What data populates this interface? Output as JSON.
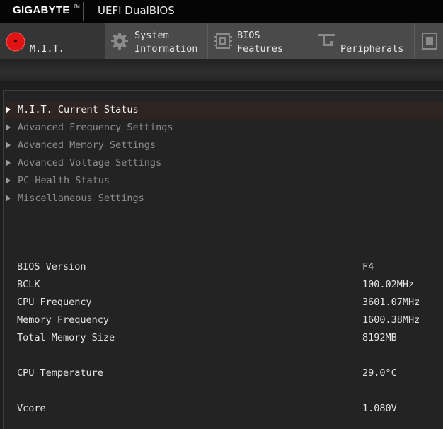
{
  "header": {
    "brand": "GIGABYTE",
    "trademark": "TM",
    "product": "UEFI DualBIOS"
  },
  "tabs": [
    {
      "line1": "",
      "line2": "M.I.T.",
      "icon": "red-status-dot-icon",
      "active": true
    },
    {
      "line1": "System",
      "line2": "Information",
      "icon": "gear-icon"
    },
    {
      "line1": "BIOS",
      "line2": "Features",
      "icon": "chip-icon"
    },
    {
      "line1": "",
      "line2": "Peripherals",
      "icon": "connector-icon"
    },
    {
      "line1": "",
      "line2": "",
      "icon": "board-icon"
    }
  ],
  "menu": [
    {
      "label": "M.I.T. Current Status",
      "selected": true
    },
    {
      "label": "Advanced Frequency Settings"
    },
    {
      "label": "Advanced Memory Settings"
    },
    {
      "label": "Advanced Voltage Settings"
    },
    {
      "label": "PC Health Status"
    },
    {
      "label": "Miscellaneous Settings"
    }
  ],
  "info": [
    {
      "label": "BIOS Version",
      "value": "F4"
    },
    {
      "label": "BCLK",
      "value": "100.02MHz"
    },
    {
      "label": "CPU Frequency",
      "value": "3601.07MHz"
    },
    {
      "label": "Memory Frequency",
      "value": "1600.38MHz"
    },
    {
      "label": "Total Memory Size",
      "value": "8192MB"
    },
    {
      "label": "CPU Temperature",
      "value": "29.0°C"
    },
    {
      "label": "Vcore",
      "value": "1.080V"
    }
  ],
  "colors": {
    "accent_red": "#e01414",
    "selected_row": "#2e2422"
  }
}
